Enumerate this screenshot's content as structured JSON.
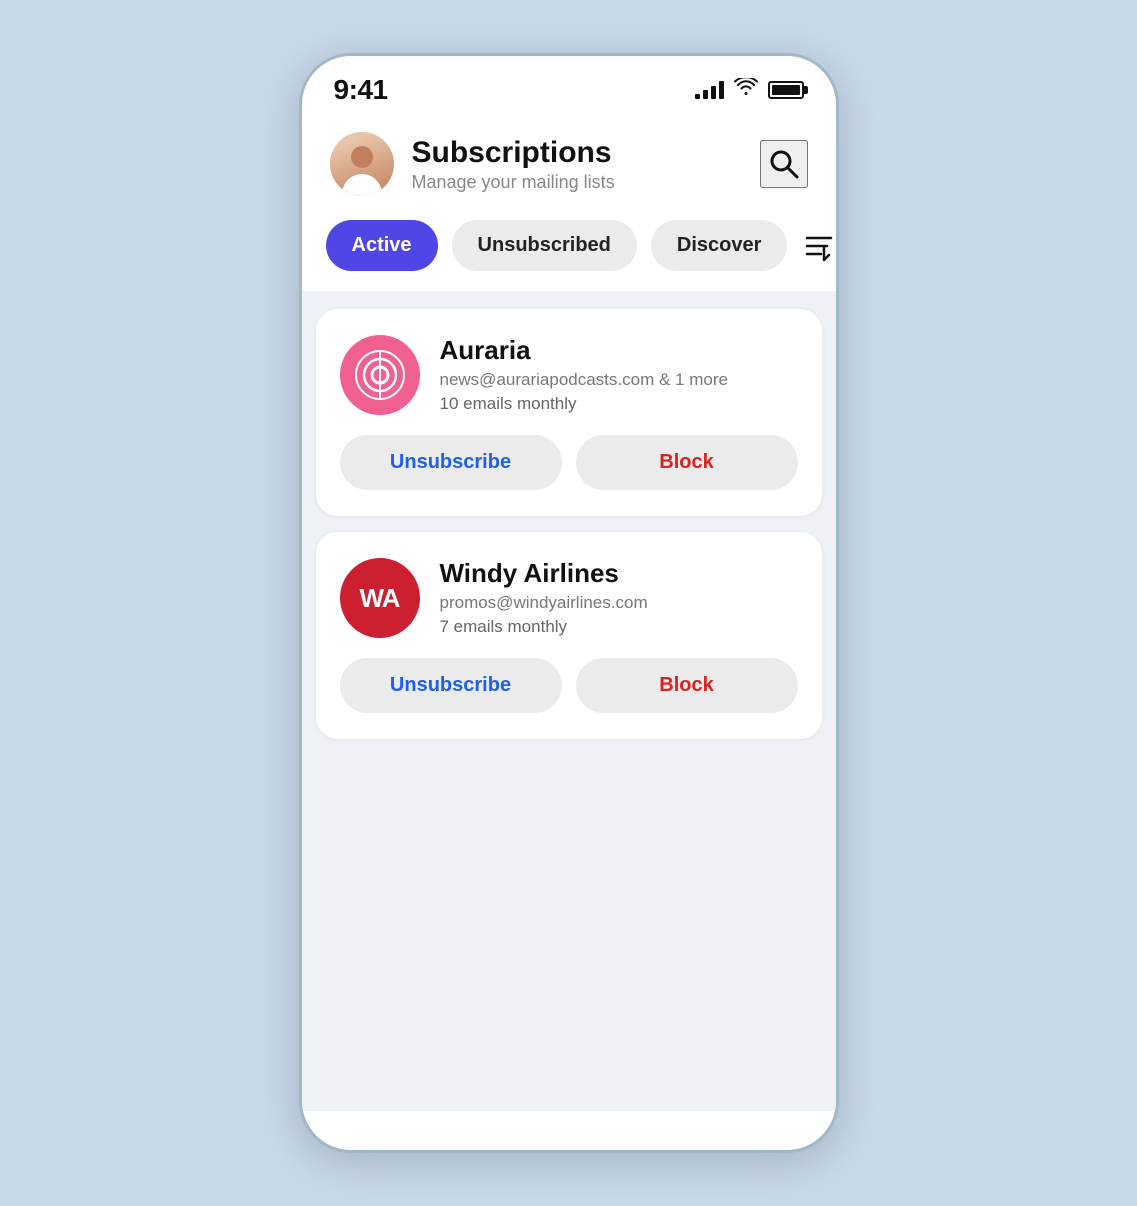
{
  "status": {
    "time": "9:41"
  },
  "header": {
    "title": "Subscriptions",
    "subtitle": "Manage your mailing lists"
  },
  "tabs": [
    {
      "id": "active",
      "label": "Active",
      "active": true
    },
    {
      "id": "unsubscribed",
      "label": "Unsubscribed",
      "active": false
    },
    {
      "id": "discover",
      "label": "Discover",
      "active": false
    }
  ],
  "subscriptions": [
    {
      "id": "auraria",
      "name": "Auraria",
      "email": "news@aurariapodcasts.com & 1 more",
      "frequency": "10 emails monthly",
      "unsubscribe_label": "Unsubscribe",
      "block_label": "Block"
    },
    {
      "id": "windy",
      "name": "Windy Airlines",
      "email": "promos@windyairlines.com",
      "frequency": "7 emails monthly",
      "unsubscribe_label": "Unsubscribe",
      "block_label": "Block"
    }
  ]
}
